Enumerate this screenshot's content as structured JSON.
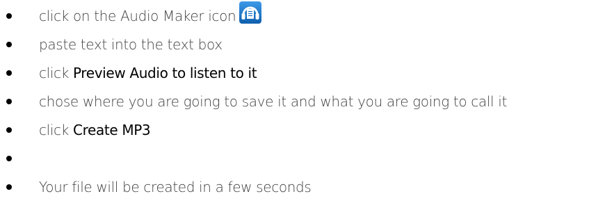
{
  "steps": [
    {
      "prefix": "click on the Audio Maker icon",
      "highlight": "",
      "suffix": ""
    },
    {
      "prefix": "paste text into the text box",
      "highlight": "",
      "suffix": ""
    },
    {
      "prefix": "click ",
      "highlight": "Preview Audio to listen to it",
      "suffix": ""
    },
    {
      "prefix": "chose where you are going to save it and what you are going to call it",
      "highlight": "",
      "suffix": ""
    },
    {
      "prefix": "click ",
      "highlight": "Create MP3",
      "suffix": ""
    },
    {
      "prefix": "",
      "highlight": "",
      "suffix": ""
    },
    {
      "prefix": "Your file will be created in a few seconds",
      "highlight": "",
      "suffix": ""
    }
  ],
  "icons": {
    "audio_maker": "headphones-document-icon"
  },
  "colors": {
    "text": "#404040",
    "emphasis": "#000000",
    "icon_blue": "#1a73c9"
  }
}
